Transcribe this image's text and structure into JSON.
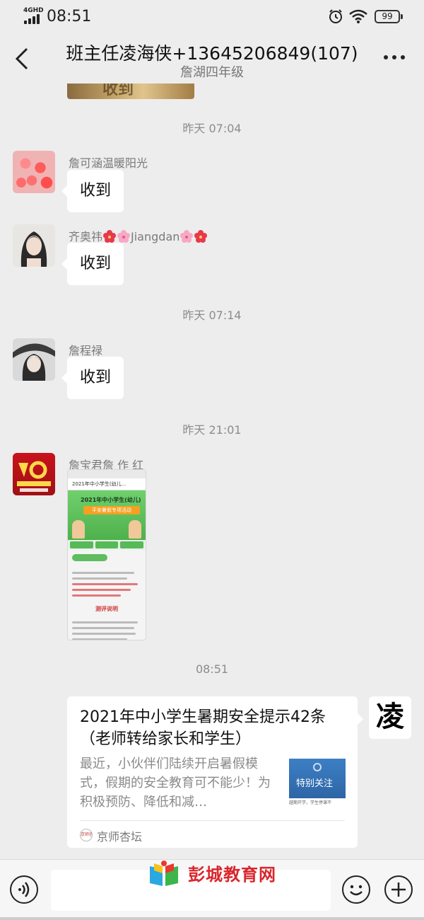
{
  "status_bar": {
    "network": "4GHD",
    "time": "08:51",
    "battery": "99"
  },
  "header": {
    "title": "班主任凌海侠+13645206849(107)",
    "subtitle": "詹湖四年级"
  },
  "previous_image_caption": "收到",
  "messages": [
    {
      "time": "昨天 07:04"
    },
    {
      "sender": "詹可涵温暖阳光",
      "text": "收到"
    },
    {
      "sender_prefix": "齐奥祎",
      "sender_name": "Jiangdan",
      "text": "收到"
    },
    {
      "time": "昨天 07:14"
    },
    {
      "sender": "詹程禄",
      "text": "收到"
    },
    {
      "time": "昨天 21:01"
    },
    {
      "sender": "詹宝君詹 作 红"
    },
    {
      "time": "08:51"
    }
  ],
  "shared_image": {
    "tab_title": "2021年中小学生(幼儿...",
    "banner_title": "2021年中小学生(幼儿)",
    "banner_subtitle": "平安暑假专项活动",
    "section_title": "测评说明"
  },
  "link_card": {
    "title": "2021年中小学生暑期安全提示42条（老师转给家长和学生）",
    "description": "最近，小伙伴们陆续开启暑假模式，假期的安全教育可不能少！为积极预防、降低和减…",
    "thumb_label": "特别关注",
    "thumb_footer": "越期开学，学生停课不",
    "source_icon_text": "京师杏坛",
    "source": "京师杏坛"
  },
  "my_avatar_char": "凌",
  "watermark": "彭城教育网",
  "colors": {
    "bubble": "#ffffff",
    "background": "#ededed",
    "watermark_red": "#d9262c"
  }
}
